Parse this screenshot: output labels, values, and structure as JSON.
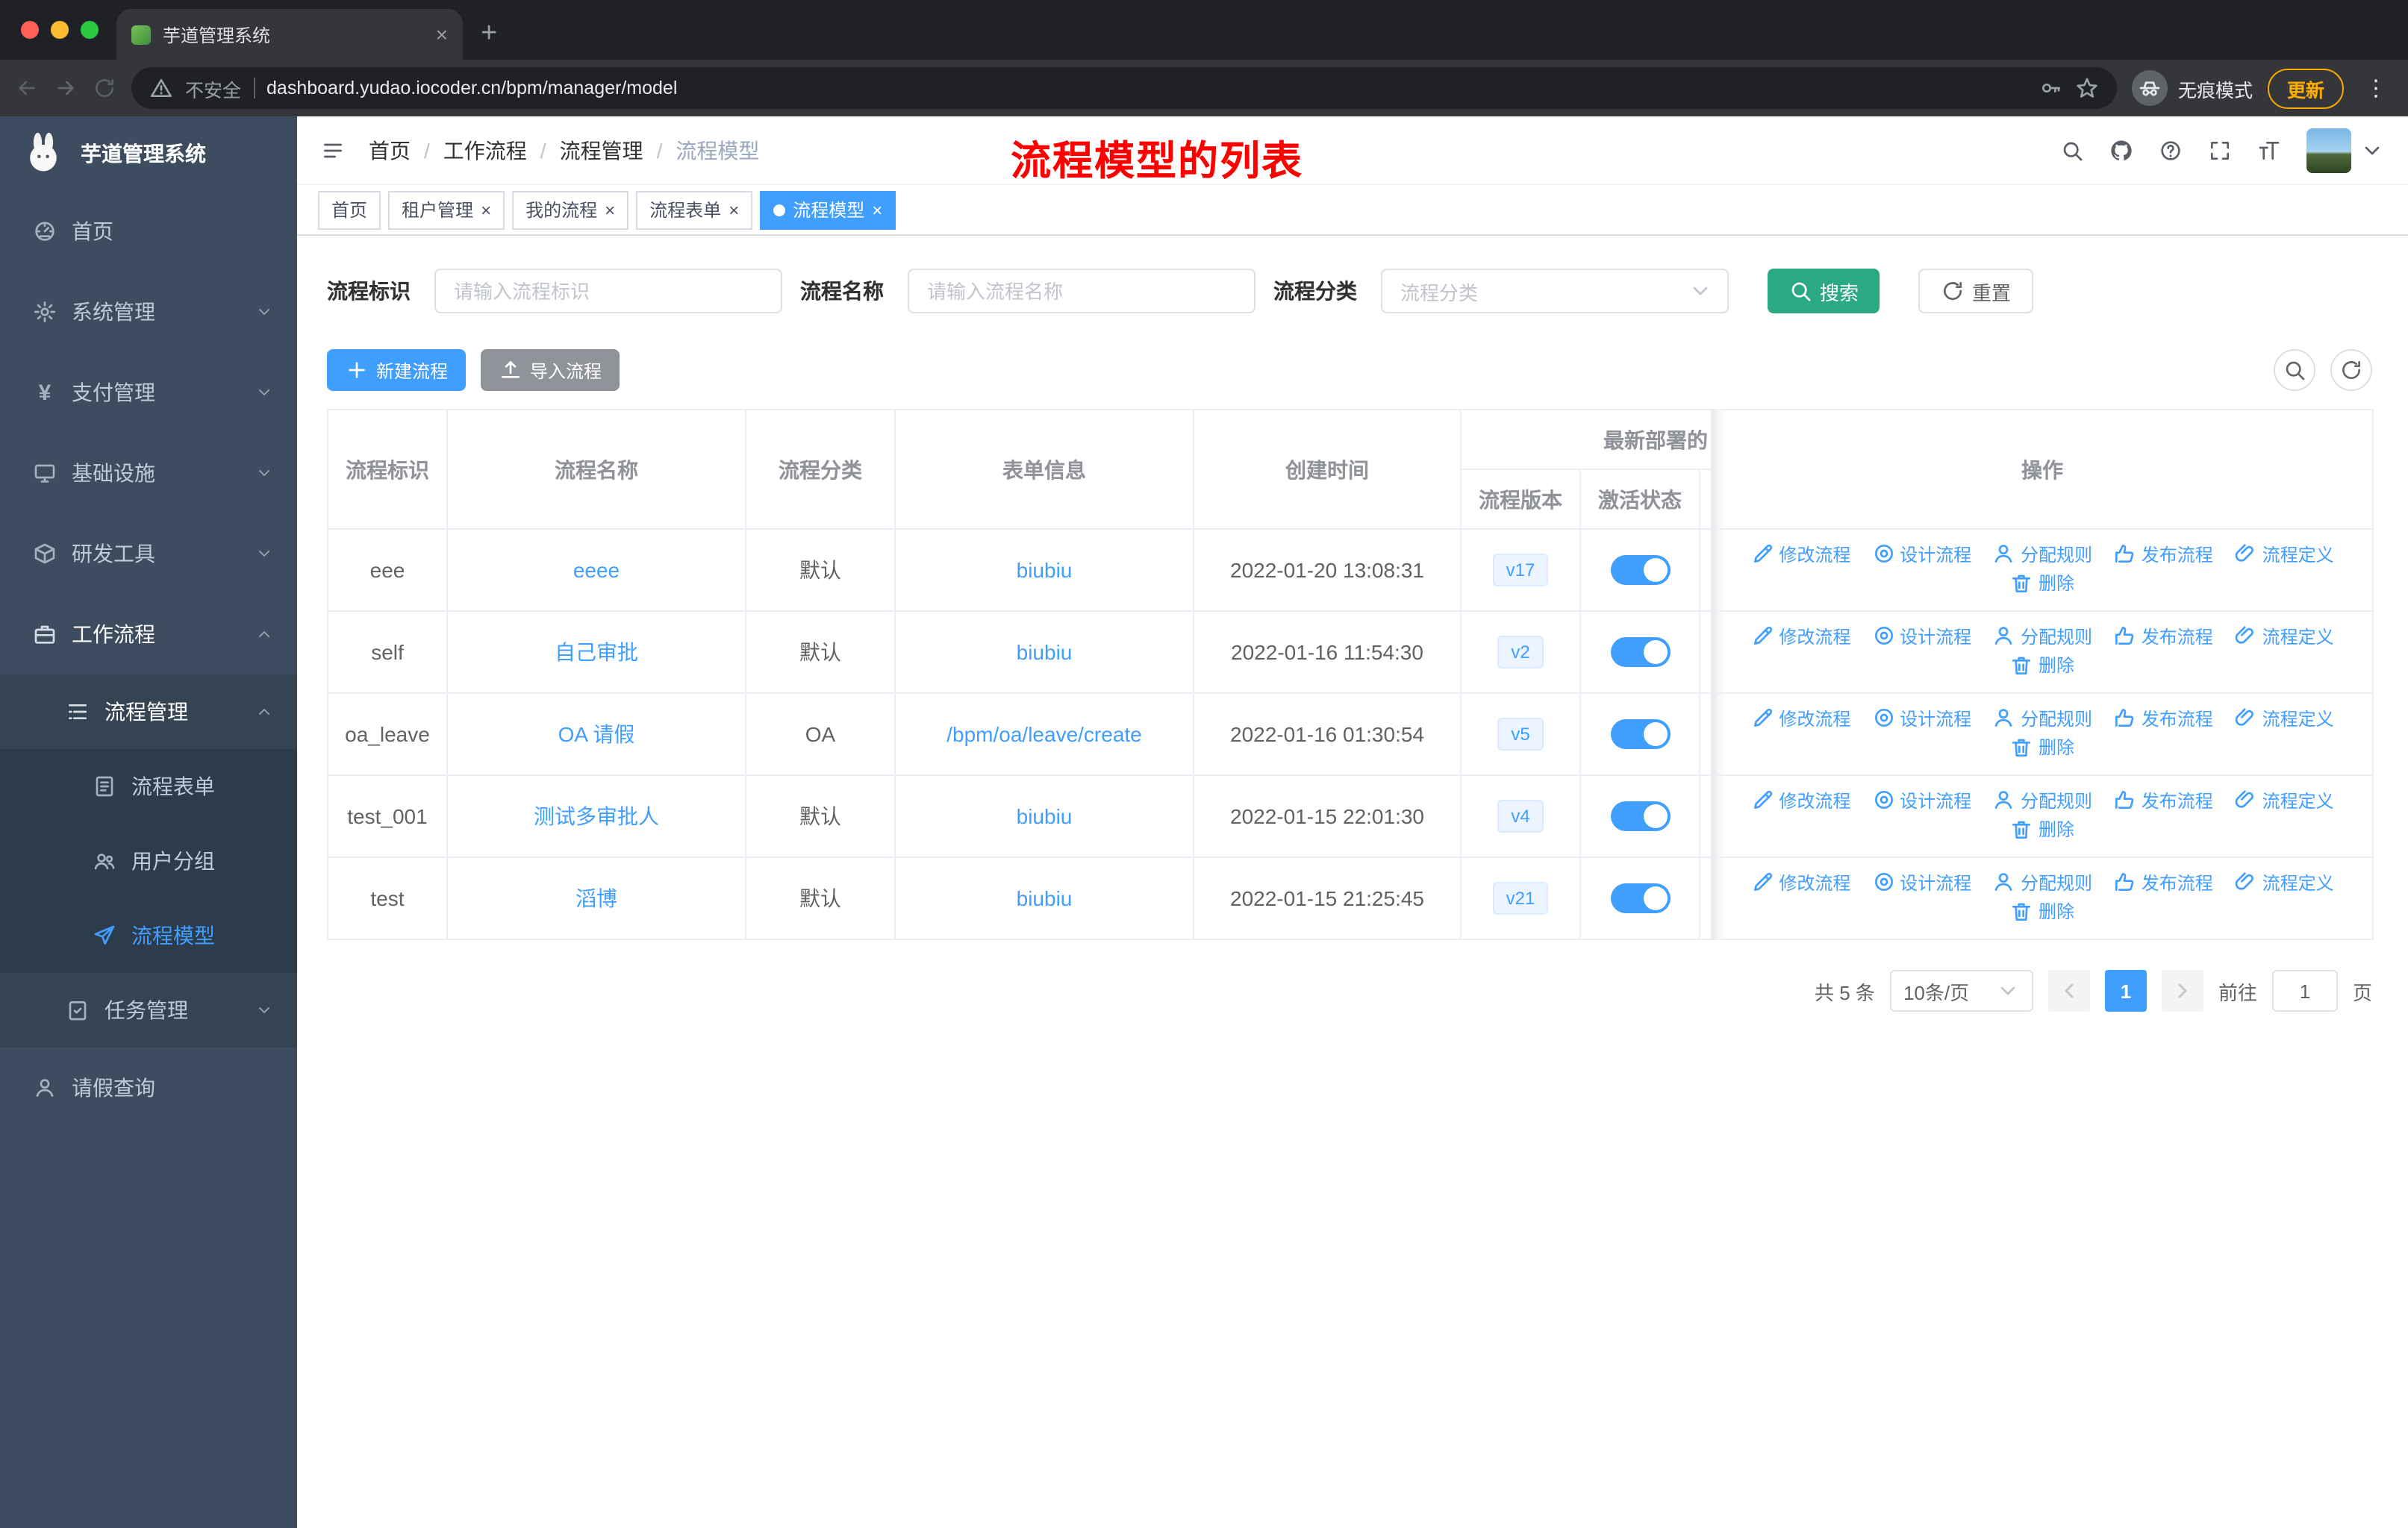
{
  "browser": {
    "tab_title": "芋道管理系统",
    "security_label": "不安全",
    "url": "dashboard.yudao.iocoder.cn/bpm/manager/model",
    "incognito_label": "无痕模式",
    "update_label": "更新"
  },
  "glyphs": {
    "close": "×",
    "new_tab": "+",
    "more": "⋮",
    "yen": "¥"
  },
  "sidebar": {
    "logo_title": "芋道管理系统",
    "home": "首页",
    "system": "系统管理",
    "pay": "支付管理",
    "infra": "基础设施",
    "dev": "研发工具",
    "workflow": "工作流程",
    "process_mgmt": "流程管理",
    "process_form": "流程表单",
    "user_group": "用户分组",
    "process_model": "流程模型",
    "task_mgmt": "任务管理",
    "leave_query": "请假查询"
  },
  "navbar": {
    "breadcrumb": [
      "首页",
      "工作流程",
      "流程管理",
      "流程模型"
    ],
    "separator": "/",
    "annotation": "流程模型的列表"
  },
  "tags": {
    "list": [
      {
        "label": "首页",
        "active": false,
        "closable": false
      },
      {
        "label": "租户管理",
        "active": false,
        "closable": true
      },
      {
        "label": "我的流程",
        "active": false,
        "closable": true
      },
      {
        "label": "流程表单",
        "active": false,
        "closable": true
      },
      {
        "label": "流程模型",
        "active": true,
        "closable": true
      }
    ]
  },
  "filters": {
    "id_label": "流程标识",
    "id_placeholder": "请输入流程标识",
    "name_label": "流程名称",
    "name_placeholder": "请输入流程名称",
    "category_label": "流程分类",
    "category_placeholder": "流程分类",
    "search_label": "搜索",
    "reset_label": "重置"
  },
  "toolbar": {
    "create_label": "新建流程",
    "import_label": "导入流程"
  },
  "table": {
    "headers": {
      "id": "流程标识",
      "name": "流程名称",
      "category": "流程分类",
      "form": "表单信息",
      "created": "创建时间",
      "deploy_group": "最新部署的",
      "version": "流程版本",
      "status": "激活状态",
      "actions": "操作"
    },
    "action_labels": [
      "修改流程",
      "设计流程",
      "分配规则",
      "发布流程",
      "流程定义",
      "删除"
    ],
    "rows": [
      {
        "id": "eee",
        "name": "eeee",
        "category": "默认",
        "form": "biubiu",
        "created": "2022-01-20 13:08:31",
        "version": "v17",
        "active": true
      },
      {
        "id": "self",
        "name": "自己审批",
        "category": "默认",
        "form": "biubiu",
        "created": "2022-01-16 11:54:30",
        "version": "v2",
        "active": true
      },
      {
        "id": "oa_leave",
        "name": "OA 请假",
        "category": "OA",
        "form": "/bpm/oa/leave/create",
        "created": "2022-01-16 01:30:54",
        "version": "v5",
        "active": true
      },
      {
        "id": "test_001",
        "name": "测试多审批人",
        "category": "默认",
        "form": "biubiu",
        "created": "2022-01-15 22:01:30",
        "version": "v4",
        "active": true
      },
      {
        "id": "test",
        "name": "滔博",
        "category": "默认",
        "form": "biubiu",
        "created": "2022-01-15 21:25:45",
        "version": "v21",
        "active": true
      }
    ]
  },
  "pagination": {
    "total": "共 5 条",
    "page_size": "10条/页",
    "current_page": "1",
    "goto_label": "前往",
    "goto_value": "1",
    "page_unit": "页"
  },
  "colors": {
    "primary": "#409eff",
    "search_button": "#2ba884",
    "annotation_red": "#ff0000",
    "sidebar_bg": "#3e4c5f",
    "update_pill_orange": "#f9ab00"
  }
}
